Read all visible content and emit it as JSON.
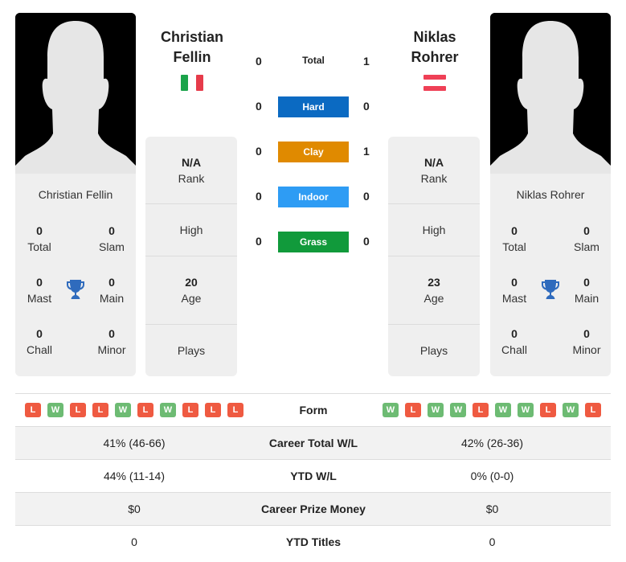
{
  "colors": {
    "hard": "#0b6ac2",
    "clay": "#e08a00",
    "indoor": "#2e9cf4",
    "grass": "#119a3b",
    "win": "#6dbb73",
    "loss": "#ef5a41",
    "trophy": "#2f6bbd"
  },
  "player1": {
    "name_line1": "Christian",
    "name_line2": "Fellin",
    "full_name": "Christian Fellin",
    "flag": "italy-flag",
    "rank": "N/A",
    "rank_label": "Rank",
    "high_label": "High",
    "age": "20",
    "age_label": "Age",
    "plays_label": "Plays",
    "titles": {
      "total": "0",
      "total_label": "Total",
      "slam": "0",
      "slam_label": "Slam",
      "mast": "0",
      "mast_label": "Mast",
      "main": "0",
      "main_label": "Main",
      "chall": "0",
      "chall_label": "Chall",
      "minor": "0",
      "minor_label": "Minor"
    },
    "form": [
      "L",
      "W",
      "L",
      "L",
      "W",
      "L",
      "W",
      "L",
      "L",
      "L"
    ]
  },
  "player2": {
    "name_line1": "Niklas",
    "name_line2": "Rohrer",
    "full_name": "Niklas Rohrer",
    "flag": "austria-flag",
    "rank": "N/A",
    "rank_label": "Rank",
    "high_label": "High",
    "age": "23",
    "age_label": "Age",
    "plays_label": "Plays",
    "titles": {
      "total": "0",
      "total_label": "Total",
      "slam": "0",
      "slam_label": "Slam",
      "mast": "0",
      "mast_label": "Mast",
      "main": "0",
      "main_label": "Main",
      "chall": "0",
      "chall_label": "Chall",
      "minor": "0",
      "minor_label": "Minor"
    },
    "form": [
      "W",
      "L",
      "W",
      "W",
      "L",
      "W",
      "W",
      "L",
      "W",
      "L"
    ]
  },
  "h2h": [
    {
      "label": "Total",
      "p1": "0",
      "p2": "1"
    },
    {
      "label": "Hard",
      "p1": "0",
      "p2": "0"
    },
    {
      "label": "Clay",
      "p1": "0",
      "p2": "1"
    },
    {
      "label": "Indoor",
      "p1": "0",
      "p2": "0"
    },
    {
      "label": "Grass",
      "p1": "0",
      "p2": "0"
    }
  ],
  "comparison": {
    "form_label": "Form",
    "rows": [
      {
        "label": "Career Total W/L",
        "p1": "41% (46-66)",
        "p2": "42% (26-36)"
      },
      {
        "label": "YTD W/L",
        "p1": "44% (11-14)",
        "p2": "0% (0-0)"
      },
      {
        "label": "Career Prize Money",
        "p1": "$0",
        "p2": "$0"
      },
      {
        "label": "YTD Titles",
        "p1": "0",
        "p2": "0"
      }
    ]
  }
}
